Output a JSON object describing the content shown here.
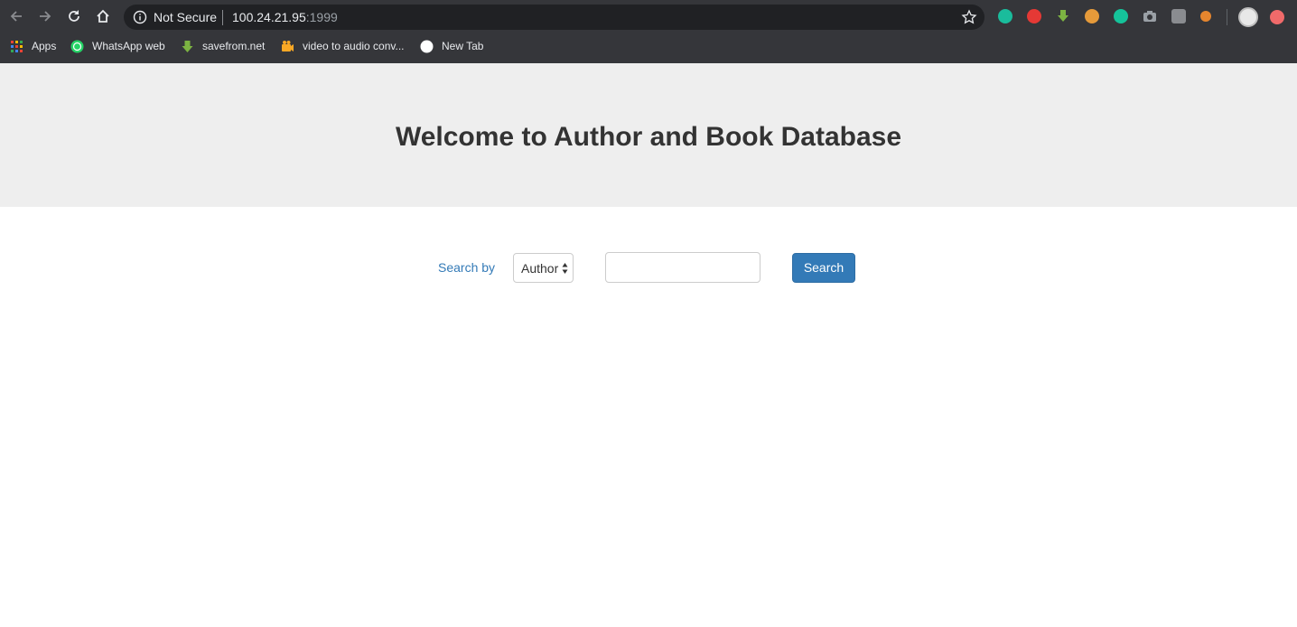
{
  "browser": {
    "security_label": "Not Secure",
    "url_host": "100.24.21.95",
    "url_port": ":1999",
    "bookmarks": [
      {
        "label": "Apps",
        "icon": "apps-grid-icon"
      },
      {
        "label": "WhatsApp web",
        "icon": "whatsapp-icon"
      },
      {
        "label": "savefrom.net",
        "icon": "download-arrow-icon"
      },
      {
        "label": "video to audio conv...",
        "icon": "camera-icon"
      },
      {
        "label": "New Tab",
        "icon": "globe-icon"
      }
    ],
    "extensions": [
      {
        "name": "mention-extension-icon",
        "color": "#1abc9c"
      },
      {
        "name": "stop-hand-extension-icon",
        "color": "#e53935"
      },
      {
        "name": "download-extension-icon",
        "color": "#7cb342"
      },
      {
        "name": "cookie-extension-icon",
        "color": "#e59a3a"
      },
      {
        "name": "grammarly-extension-icon",
        "color": "#15c39a"
      },
      {
        "name": "camera-extension-icon",
        "color": "#9aa0a6"
      },
      {
        "name": "s-extension-icon",
        "color": "#8a8c90"
      },
      {
        "name": "orange-extension-icon",
        "color": "#e6862e"
      }
    ]
  },
  "page": {
    "title": "Welcome to Author and Book Database",
    "search": {
      "label": "Search by",
      "select_value": "Author",
      "input_value": "",
      "button_label": "Search"
    }
  },
  "colors": {
    "jumbotron_bg": "#eeeeee",
    "primary": "#337ab7",
    "chrome_bg": "#35363a"
  }
}
